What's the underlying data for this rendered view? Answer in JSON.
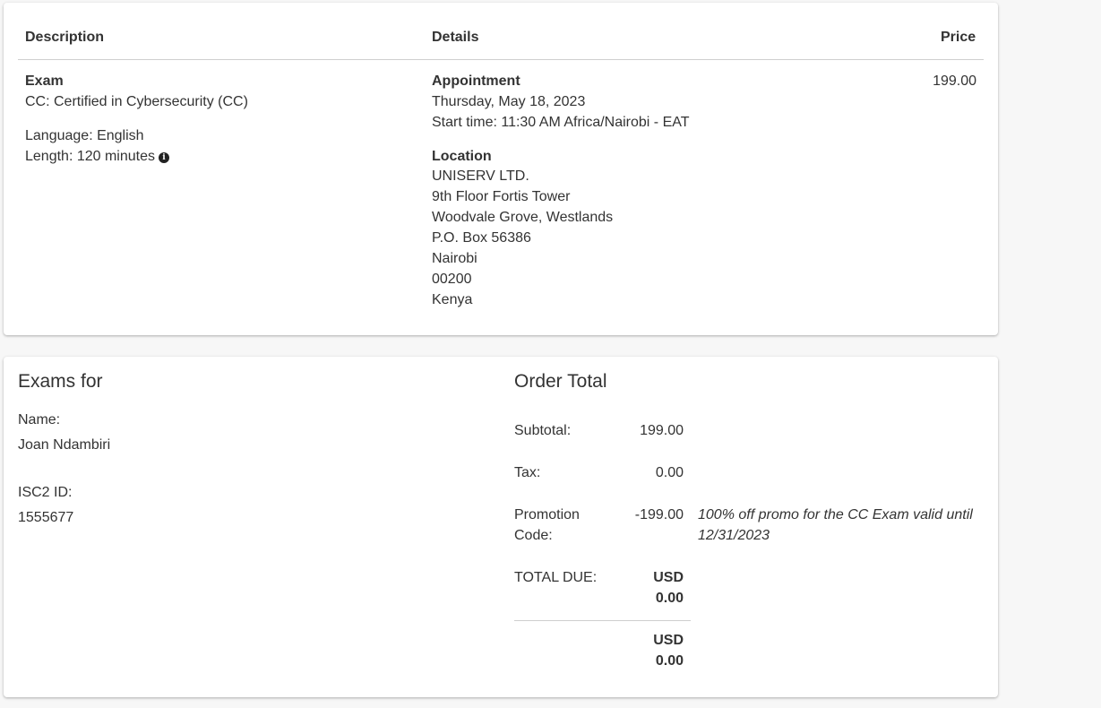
{
  "order_table": {
    "headers": {
      "description": "Description",
      "details": "Details",
      "price": "Price"
    },
    "item": {
      "type": "Exam",
      "name": "CC: Certified in Cybersecurity (CC)",
      "language": "Language: English",
      "length": "Length: 120 minutes",
      "appointment_label": "Appointment",
      "appointment_date": "Thursday, May 18, 2023",
      "start_time": "Start time: 11:30 AM Africa/Nairobi - EAT",
      "location_label": "Location",
      "location_lines": [
        "UNISERV LTD.",
        "9th Floor Fortis Tower",
        "Woodvale Grove, Westlands",
        "P.O. Box 56386",
        "Nairobi",
        "00200",
        "Kenya"
      ],
      "price": "199.00"
    }
  },
  "exams_for": {
    "title": "Exams for",
    "name_label": "Name:",
    "name_value": "Joan Ndambiri",
    "id_label": "ISC2 ID:",
    "id_value": "1555677"
  },
  "order_total": {
    "title": "Order Total",
    "subtotal_label": "Subtotal:",
    "subtotal_value": "199.00",
    "tax_label": "Tax:",
    "tax_value": "0.00",
    "promo_label_line1": "Promotion",
    "promo_label_line2": "Code:",
    "promo_value": "-199.00",
    "promo_note_line1": "100% off promo for the CC Exam valid until",
    "promo_note_line2": "12/31/2023",
    "total_label": "TOTAL DUE:",
    "total_currency": "USD",
    "total_amount": "0.00",
    "final_currency": "USD",
    "final_amount": "0.00"
  },
  "icons": {
    "length_info": "info-circle-icon"
  }
}
